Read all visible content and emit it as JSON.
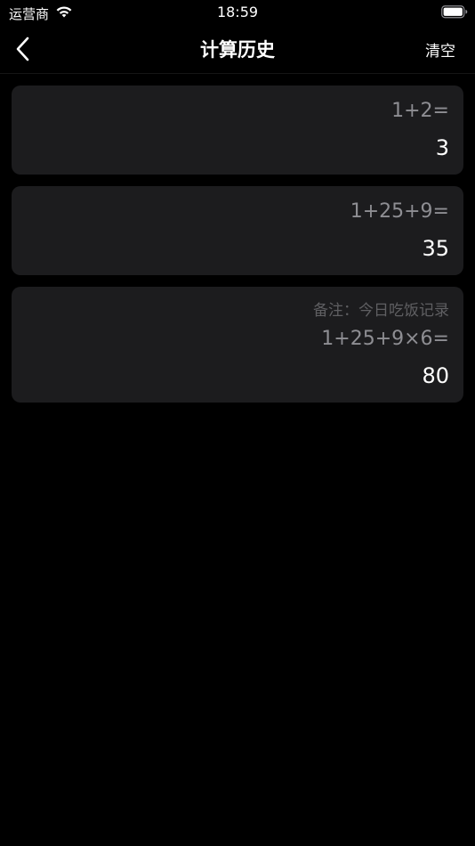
{
  "status_bar": {
    "carrier": "运营商",
    "time": "18:59",
    "wifi_icon": "wifi-icon",
    "battery_icon": "battery-icon"
  },
  "nav": {
    "title": "计算历史",
    "clear_label": "清空",
    "back_icon": "chevron-left-icon"
  },
  "history": [
    {
      "expression": "1+2=",
      "result": "3"
    },
    {
      "expression": "1+25+9=",
      "result": "35"
    },
    {
      "note": "备注：今日吃饭记录",
      "expression": "1+25+9×6=",
      "result": "80"
    }
  ],
  "colors": {
    "background": "#000000",
    "card": "#1c1c1e",
    "expression_text": "#8e8e93",
    "note_text": "#5f5f62",
    "result_text": "#ffffff"
  }
}
